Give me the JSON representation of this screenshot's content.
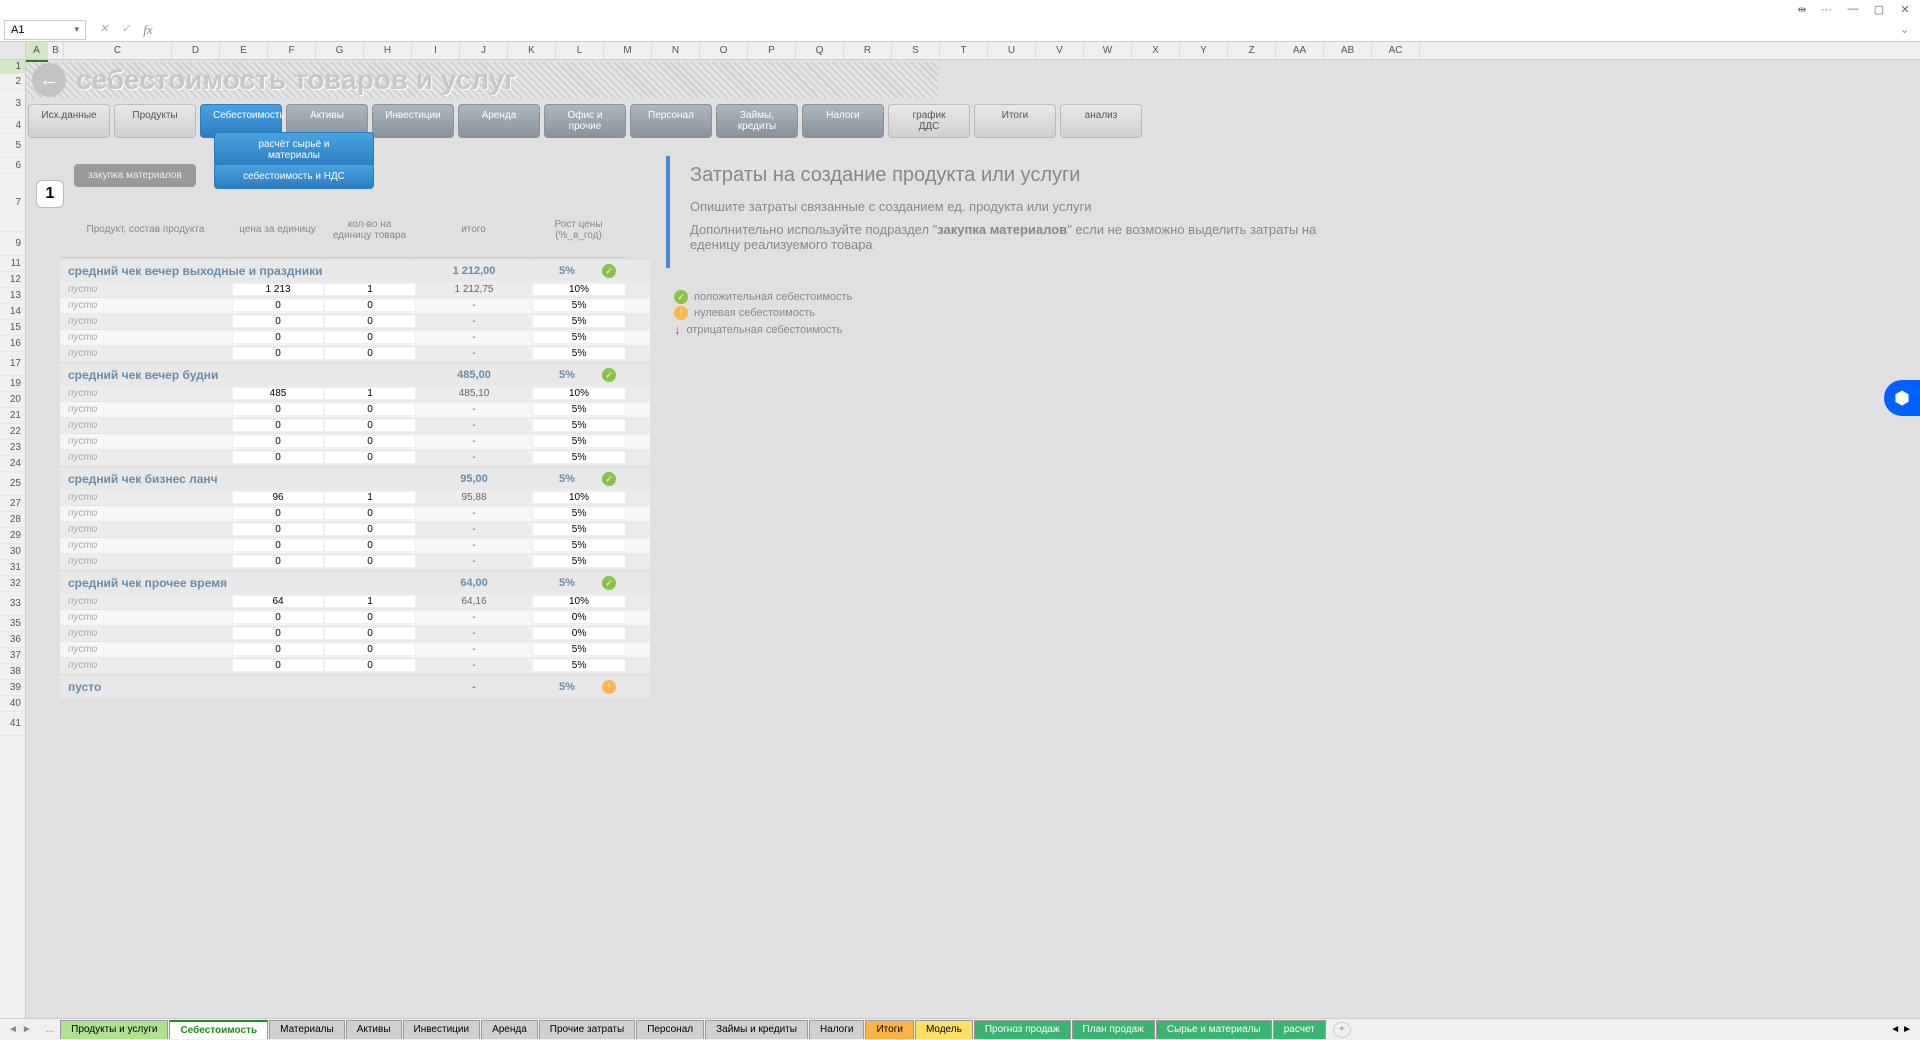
{
  "titlebar": {},
  "formulabar": {
    "cell_ref": "A1",
    "formula": ""
  },
  "columns": [
    "A",
    "B",
    "C",
    "D",
    "E",
    "F",
    "G",
    "H",
    "I",
    "J",
    "K",
    "L",
    "M",
    "N",
    "O",
    "P",
    "Q",
    "R",
    "S",
    "T",
    "U",
    "V",
    "W",
    "X",
    "Y",
    "Z",
    "AA",
    "AB",
    "AC"
  ],
  "rows": [
    1,
    2,
    3,
    4,
    5,
    6,
    7,
    9,
    11,
    12,
    13,
    14,
    15,
    16,
    17,
    19,
    20,
    21,
    22,
    23,
    24,
    25,
    27,
    28,
    29,
    30,
    31,
    32,
    33,
    35,
    36,
    37,
    38,
    39,
    40,
    41
  ],
  "page_title": "себестоимость товаров и услуг",
  "nav": [
    "Исх.данные",
    "Продукты",
    "Себестоимость",
    "Активы",
    "Инвестиции",
    "Аренда",
    "Офис и прочие",
    "Персонал",
    "Займы, кредиты",
    "Налоги",
    "график ДДС",
    "Итоги",
    "анализ"
  ],
  "nav_active_idx": 2,
  "subnav": [
    "расчёт сырьё и материалы",
    "себестоимость и НДС"
  ],
  "side_button": "закупка материалов",
  "circle_num": "1",
  "table": {
    "headers": [
      "Продукт, состав продукта",
      "цена за единицу",
      "кол-во на единицу товара",
      "итого",
      "Рост цены (%_в_год)"
    ],
    "sections": [
      {
        "name": "средний чек вечер выходные и праздники",
        "total": "1 212,00",
        "pct": "5%",
        "status": "ok",
        "rows": [
          {
            "n": "пусто",
            "p": "1 213",
            "q": "1",
            "t": "1 212,75",
            "g": "10%"
          },
          {
            "n": "пусто",
            "p": "0",
            "q": "0",
            "t": "-",
            "g": "5%"
          },
          {
            "n": "пусто",
            "p": "0",
            "q": "0",
            "t": "-",
            "g": "5%"
          },
          {
            "n": "пусто",
            "p": "0",
            "q": "0",
            "t": "-",
            "g": "5%"
          },
          {
            "n": "пусто",
            "p": "0",
            "q": "0",
            "t": "-",
            "g": "5%"
          }
        ]
      },
      {
        "name": "средний чек вечер будни",
        "total": "485,00",
        "pct": "5%",
        "status": "ok",
        "rows": [
          {
            "n": "пусто",
            "p": "485",
            "q": "1",
            "t": "485,10",
            "g": "10%"
          },
          {
            "n": "пусто",
            "p": "0",
            "q": "0",
            "t": "-",
            "g": "5%"
          },
          {
            "n": "пусто",
            "p": "0",
            "q": "0",
            "t": "-",
            "g": "5%"
          },
          {
            "n": "пусто",
            "p": "0",
            "q": "0",
            "t": "-",
            "g": "5%"
          },
          {
            "n": "пусто",
            "p": "0",
            "q": "0",
            "t": "-",
            "g": "5%"
          }
        ]
      },
      {
        "name": "средний чек бизнес ланч",
        "total": "95,00",
        "pct": "5%",
        "status": "ok",
        "rows": [
          {
            "n": "пусто",
            "p": "96",
            "q": "1",
            "t": "95,88",
            "g": "10%"
          },
          {
            "n": "пусто",
            "p": "0",
            "q": "0",
            "t": "-",
            "g": "5%"
          },
          {
            "n": "пусто",
            "p": "0",
            "q": "0",
            "t": "-",
            "g": "5%"
          },
          {
            "n": "пусто",
            "p": "0",
            "q": "0",
            "t": "-",
            "g": "5%"
          },
          {
            "n": "пусто",
            "p": "0",
            "q": "0",
            "t": "-",
            "g": "5%"
          }
        ]
      },
      {
        "name": "средний чек прочее время",
        "total": "64,00",
        "pct": "5%",
        "status": "ok",
        "rows": [
          {
            "n": "пусто",
            "p": "64",
            "q": "1",
            "t": "64,16",
            "g": "10%"
          },
          {
            "n": "пусто",
            "p": "0",
            "q": "0",
            "t": "-",
            "g": "0%"
          },
          {
            "n": "пусто",
            "p": "0",
            "q": "0",
            "t": "-",
            "g": "0%"
          },
          {
            "n": "пусто",
            "p": "0",
            "q": "0",
            "t": "-",
            "g": "5%"
          },
          {
            "n": "пусто",
            "p": "0",
            "q": "0",
            "t": "-",
            "g": "5%"
          }
        ]
      },
      {
        "name": "пусто",
        "total": "-",
        "pct": "5%",
        "status": "warn",
        "rows": []
      }
    ]
  },
  "info": {
    "title": "Затраты на создание продукта или услуги",
    "line1": "Опишите затраты связанные с созданием ед. продукта или услуги",
    "line2a": "Дополнительно используйте подраздел \"",
    "line2b": "закупка материалов",
    "line2c": "\" если не возможно выделить затраты на еденицу реализуемого товара",
    "legend": [
      {
        "icon": "ok",
        "text": "положительная себестоимость"
      },
      {
        "icon": "warn",
        "text": "нулевая себестоимость"
      },
      {
        "icon": "neg",
        "text": "отрицательная себестоимость"
      }
    ]
  },
  "sheet_tabs": [
    {
      "label": "Продукты и услуги",
      "cls": "green-l"
    },
    {
      "label": "Себестоимость",
      "cls": "green-l active"
    },
    {
      "label": "Материалы",
      "cls": "gray"
    },
    {
      "label": "Активы",
      "cls": "gray"
    },
    {
      "label": "Инвестиции",
      "cls": "gray"
    },
    {
      "label": "Аренда",
      "cls": "gray"
    },
    {
      "label": "Прочие затраты",
      "cls": "gray"
    },
    {
      "label": "Персонал",
      "cls": "gray"
    },
    {
      "label": "Займы и кредиты",
      "cls": "gray"
    },
    {
      "label": "Налоги",
      "cls": "gray"
    },
    {
      "label": "Итоги",
      "cls": "orange"
    },
    {
      "label": "Модель",
      "cls": "yellow"
    },
    {
      "label": "Прогноз продаж",
      "cls": "green-d"
    },
    {
      "label": "План продаж",
      "cls": "green-d"
    },
    {
      "label": "Сырье и материалы",
      "cls": "green-d"
    },
    {
      "label": "расчет",
      "cls": "green-d"
    }
  ]
}
